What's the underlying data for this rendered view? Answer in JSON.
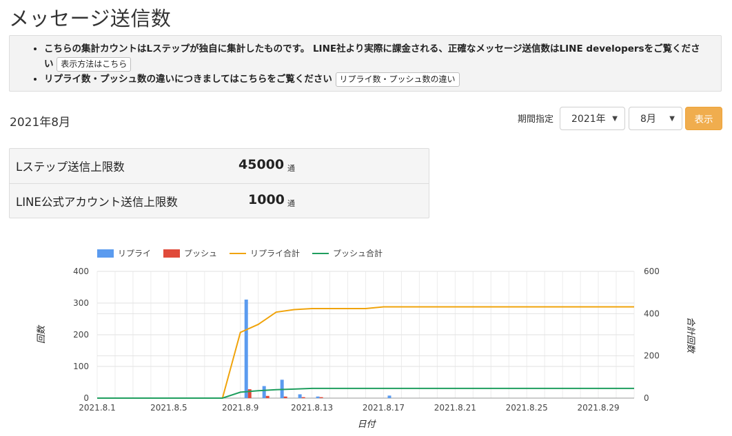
{
  "page": {
    "title": "メッセージ送信数"
  },
  "notice": {
    "line1": "こちらの集計カウントはLステップが独自に集計したものです。 LINE社より実際に課金される、正確なメッセージ送信数はLINE developersをご覧くださ",
    "line1_tail": "い",
    "line1_button": "表示方法はこちら",
    "line2": "リプライ数・プッシュ数の違いにつきましてはこちらをご覧ください",
    "line2_button": "リプライ数・プッシュ数の違い"
  },
  "month_label": "2021年8月",
  "period": {
    "label": "期間指定",
    "year_selected": "2021年",
    "month_selected": "8月",
    "show_button": "表示"
  },
  "limits": [
    {
      "label": "Lステップ送信上限数",
      "value": "45000",
      "unit": "通"
    },
    {
      "label": "LINE公式アカウント送信上限数",
      "value": "1000",
      "unit": "通"
    }
  ],
  "colors": {
    "reply": "#5b9bef",
    "push": "#e04a3a",
    "reply_total": "#f0a30a",
    "push_total": "#1e9e5e",
    "accent_button": "#f0ad4e"
  },
  "chart_data": {
    "type": "bar",
    "x": [
      "2021.8.1",
      "2021.8.2",
      "2021.8.3",
      "2021.8.4",
      "2021.8.5",
      "2021.8.6",
      "2021.8.7",
      "2021.8.8",
      "2021.8.9",
      "2021.8.10",
      "2021.8.11",
      "2021.8.12",
      "2021.8.13",
      "2021.8.14",
      "2021.8.15",
      "2021.8.16",
      "2021.8.17",
      "2021.8.18",
      "2021.8.19",
      "2021.8.20",
      "2021.8.21",
      "2021.8.22",
      "2021.8.23",
      "2021.8.24",
      "2021.8.25",
      "2021.8.26",
      "2021.8.27",
      "2021.8.28",
      "2021.8.29",
      "2021.8.30",
      "2021.8.31"
    ],
    "x_tick_labels": [
      "2021.8.1",
      "2021.8.5",
      "2021.8.9",
      "2021.8.13",
      "2021.8.17",
      "2021.8.21",
      "2021.8.25",
      "2021.8.29"
    ],
    "series": [
      {
        "name": "リプライ",
        "type": "bar",
        "axis": "left",
        "values": [
          0,
          0,
          0,
          0,
          0,
          0,
          0,
          0,
          311,
          38,
          58,
          12,
          5,
          0,
          0,
          0,
          8,
          0,
          0,
          0,
          0,
          0,
          0,
          0,
          0,
          0,
          0,
          0,
          0,
          0,
          0
        ]
      },
      {
        "name": "プッシュ",
        "type": "bar",
        "axis": "left",
        "values": [
          0,
          0,
          0,
          0,
          0,
          0,
          0,
          0,
          28,
          7,
          5,
          3,
          3,
          0,
          0,
          0,
          0,
          0,
          0,
          0,
          0,
          0,
          0,
          0,
          0,
          0,
          0,
          0,
          0,
          0,
          0
        ]
      },
      {
        "name": "リプライ合計",
        "type": "line",
        "axis": "right",
        "values": [
          0,
          0,
          0,
          0,
          0,
          0,
          0,
          0,
          311,
          349,
          407,
          419,
          424,
          424,
          424,
          424,
          432,
          432,
          432,
          432,
          432,
          432,
          432,
          432,
          432,
          432,
          432,
          432,
          432,
          432,
          432
        ]
      },
      {
        "name": "プッシュ合計",
        "type": "line",
        "axis": "right",
        "values": [
          0,
          0,
          0,
          0,
          0,
          0,
          0,
          0,
          28,
          35,
          40,
          43,
          46,
          46,
          46,
          46,
          46,
          46,
          46,
          46,
          46,
          46,
          46,
          46,
          46,
          46,
          46,
          46,
          46,
          46,
          46
        ]
      }
    ],
    "ylabel": "回数",
    "ylabel_right": "合計回数",
    "xlabel": "日付",
    "ylim": [
      0,
      400
    ],
    "ylim_right": [
      0,
      600
    ],
    "y_ticks": [
      "0",
      "100",
      "200",
      "300",
      "400"
    ],
    "y_ticks_right": [
      "0",
      "200",
      "400",
      "600"
    ],
    "grid": true,
    "legend": "top-left"
  }
}
